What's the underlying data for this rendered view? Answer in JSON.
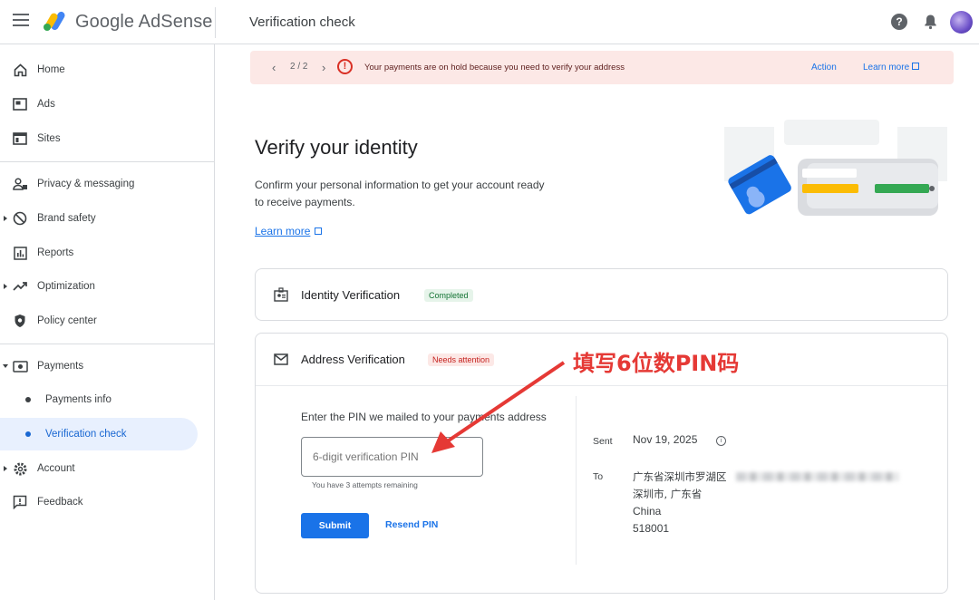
{
  "header": {
    "brand": "Google AdSense",
    "page_title": "Verification check"
  },
  "sidebar": {
    "items": [
      {
        "label": "Home"
      },
      {
        "label": "Ads"
      },
      {
        "label": "Sites"
      },
      {
        "label": "Privacy & messaging"
      },
      {
        "label": "Brand safety"
      },
      {
        "label": "Reports"
      },
      {
        "label": "Optimization"
      },
      {
        "label": "Policy center"
      },
      {
        "label": "Payments"
      },
      {
        "label": "Payments info"
      },
      {
        "label": "Verification check"
      },
      {
        "label": "Account"
      },
      {
        "label": "Feedback"
      }
    ]
  },
  "alert": {
    "count": "2 / 2",
    "message": "Your payments are on hold because you need to verify your address",
    "action": "Action",
    "learn_more": "Learn more"
  },
  "main": {
    "title": "Verify your identity",
    "description": "Confirm your personal information to get your account ready to receive payments.",
    "learn_more": "Learn more"
  },
  "identity": {
    "title": "Identity Verification",
    "status": "Completed"
  },
  "address": {
    "title": "Address Verification",
    "status": "Needs attention",
    "pin_label": "Enter the PIN we mailed to your payments address",
    "pin_placeholder": "6-digit verification PIN",
    "attempts": "You have 3 attempts remaining",
    "submit": "Submit",
    "resend": "Resend PIN",
    "sent_label": "Sent",
    "sent_date": "Nov 19, 2025",
    "to_label": "To",
    "addr_line1": "广东省深圳市罗湖区",
    "addr_line2": "深圳市, 广东省",
    "addr_line3": "China",
    "addr_line4": "518001"
  },
  "annotation": {
    "text": "填写6位数PIN码"
  },
  "colors": {
    "accent": "#1a73e8",
    "alert_bg": "#fce8e6",
    "error": "#d93025",
    "success_bg": "#e6f4ea",
    "annotation": "#e53935"
  }
}
